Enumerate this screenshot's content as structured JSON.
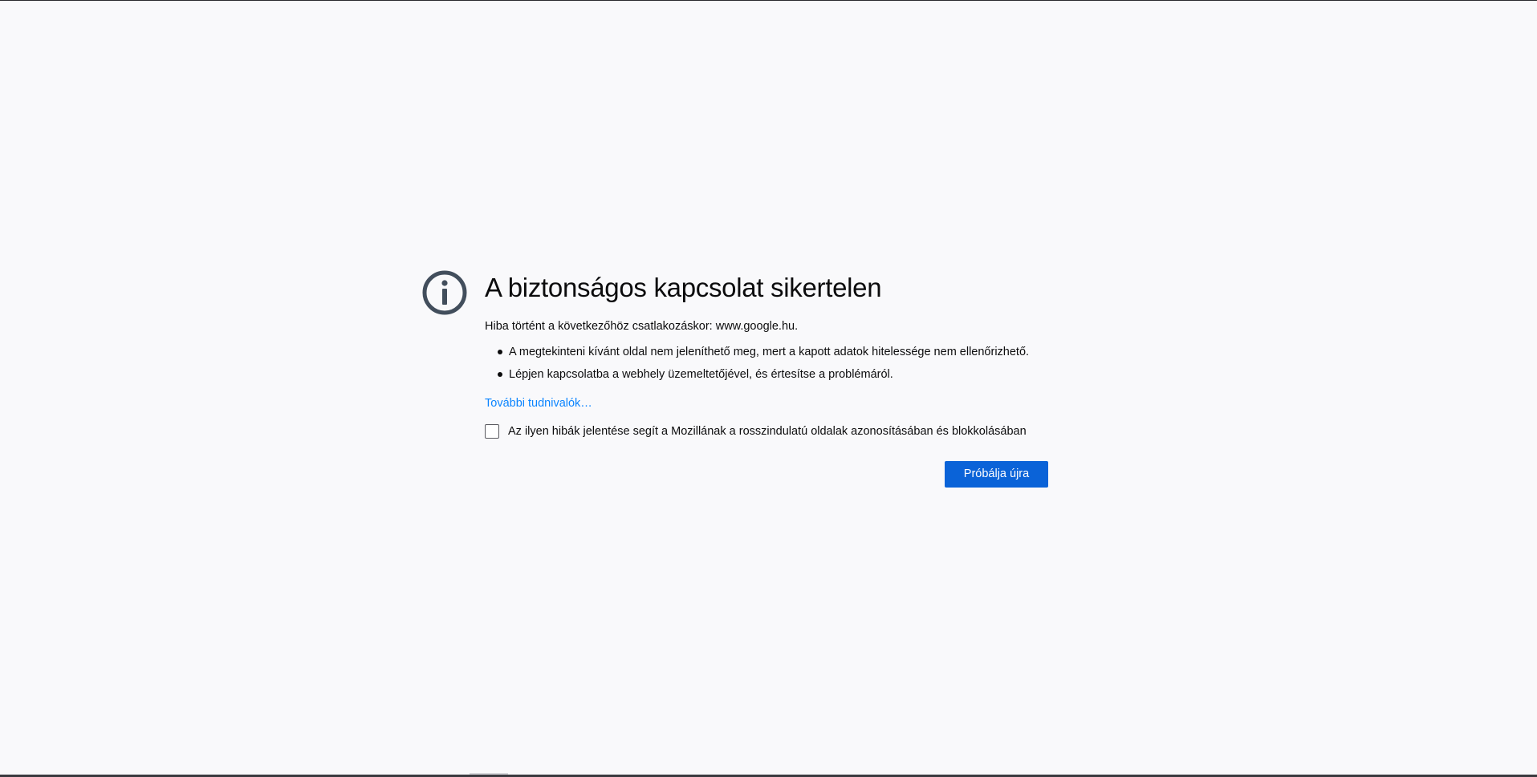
{
  "error_page": {
    "icon": "info-icon",
    "title": "A biztonságos kapcsolat sikertelen",
    "description": "Hiba történt a következőhöz csatlakozáskor: www.google.hu.",
    "bullets": [
      "A megtekinteni kívánt oldal nem jeleníthető meg, mert a kapott adatok hitelessége nem ellenőrizhető.",
      "Lépjen kapcsolatba a webhely üzemeltetőjével, és értesítse a problémáról."
    ],
    "learn_more": "További tudnivalók…",
    "report_checkbox": {
      "label": "Az ilyen hibák jelentése segít a Mozillának a rosszindulatú oldalak azonosításában és blokkolásában",
      "checked": false
    },
    "try_again_label": "Próbálja újra"
  },
  "colors": {
    "background": "#f9f9fb",
    "icon": "#424e5c",
    "link": "#0a84ff",
    "button": "#0a63d8",
    "text": "#0c0c0d"
  }
}
